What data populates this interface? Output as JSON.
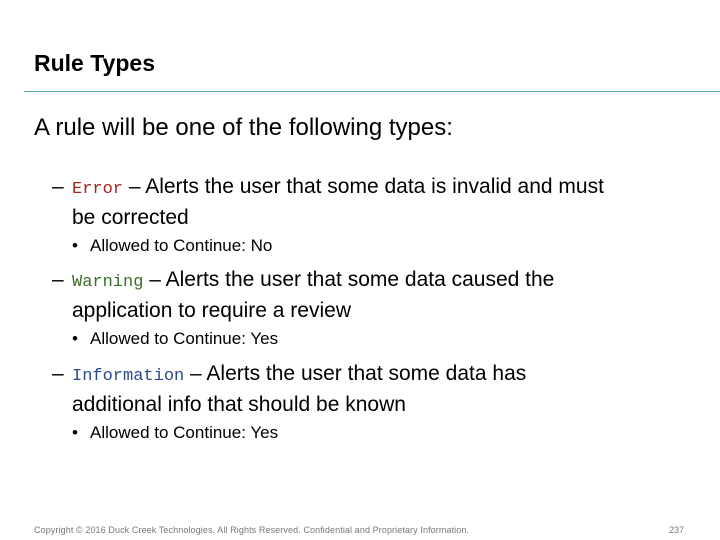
{
  "slide": {
    "title": "Rule Types",
    "lead": "A rule will be one of the following types:",
    "items": [
      {
        "dash": "–",
        "code": "Error",
        "text_line1": " – Alerts the user that some data is invalid and must",
        "text_line2": "be corrected",
        "sub": "Allowed to Continue: No",
        "code_color": "#a0261e"
      },
      {
        "dash": "–",
        "code": "Warning",
        "text_line1": " – Alerts the user that some data caused the",
        "text_line2": "application to require a review",
        "sub": "Allowed to Continue: Yes",
        "code_color": "#3a6e2a"
      },
      {
        "dash": "–",
        "code": "Information",
        "text_line1": " – Alerts the user that some data has",
        "text_line2": "additional info that should be known",
        "sub": "Allowed to Continue: Yes",
        "code_color": "#2b4a8c"
      }
    ],
    "bullet": "•",
    "footer": "Copyright © 2016 Duck Creek Technologies. All Rights Reserved. Confidential and Proprietary Information.",
    "page_number": "237"
  }
}
